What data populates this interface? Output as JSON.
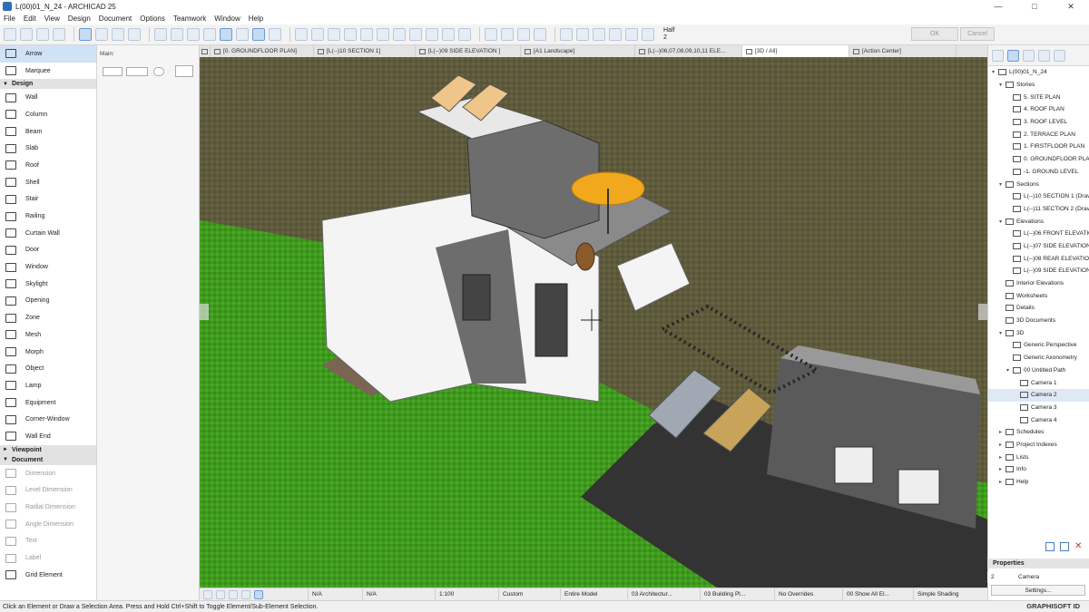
{
  "window": {
    "title": "L(00)01_N_24 - ARCHICAD 25",
    "min": "—",
    "max": "□",
    "close": "✕"
  },
  "menu": [
    "File",
    "Edit",
    "View",
    "Design",
    "Document",
    "Options",
    "Teamwork",
    "Window",
    "Help"
  ],
  "toolbar": {
    "half_label": "Half",
    "half_value": "2",
    "ok": "OK",
    "cancel": "Cancel"
  },
  "tabs": [
    "[0. GROUNDFLOOR PLAN]",
    "[L(--)10 SECTION 1]",
    "[L(--)09 SIDE ELEVATION ]",
    "[A1 Landscape]",
    "[L(--)06,07,08,09,10,11 ELE...",
    "[3D / All]",
    "[Action Center]"
  ],
  "toolbox": {
    "select": [
      {
        "label": "Arrow",
        "active": true
      },
      {
        "label": "Marquee"
      }
    ],
    "design_title": "Design",
    "design": [
      "Wall",
      "Column",
      "Beam",
      "Slab",
      "Roof",
      "Shell",
      "Stair",
      "Railing",
      "Curtain Wall",
      "Door",
      "Window",
      "Skylight",
      "Opening",
      "Zone",
      "Mesh",
      "Morph",
      "Object",
      "Lamp",
      "Equipment",
      "Corner-Window",
      "Wall End"
    ],
    "viewpoint_title": "Viewpoint",
    "document_title": "Document",
    "document": [
      "Dimension",
      "Level Dimension",
      "Radial Dimension",
      "Angle Dimension",
      "Text",
      "Label",
      "Grid Element"
    ]
  },
  "infobox": {
    "main_label": "Main:"
  },
  "view_status": [
    "N/A",
    "N/A",
    "1:100",
    "Custom",
    "Entire Model",
    "03 Architectur...",
    "03 Building Pl...",
    "No Overrides",
    "00 Show All El...",
    "Simple Shading"
  ],
  "status_text": "Click an Element or Draw a Selection Area. Press and Hold Ctrl+Shift to Toggle Element/Sub-Element Selection.",
  "graphisoft_id": "GRAPHISOFT ID",
  "navigator": {
    "tree": [
      {
        "label": "L(00)01_N_24",
        "level": 0,
        "tw": "▾"
      },
      {
        "label": "Stories",
        "level": 1,
        "tw": "▾"
      },
      {
        "label": "5. SITE PLAN",
        "level": 2
      },
      {
        "label": "4. ROOF PLAN",
        "level": 2
      },
      {
        "label": "3. ROOF LEVEL",
        "level": 2
      },
      {
        "label": "2. TERRACE PLAN",
        "level": 2
      },
      {
        "label": "1. FIRSTFLOOR PLAN",
        "level": 2
      },
      {
        "label": "0. GROUNDFLOOR PLA",
        "level": 2
      },
      {
        "label": "-1. GROUND LEVEL",
        "level": 2
      },
      {
        "label": "Sections",
        "level": 1,
        "tw": "▾"
      },
      {
        "label": "L(--)10 SECTION 1 (Drav",
        "level": 2
      },
      {
        "label": "L(--)11 SECTION 2 (Drav",
        "level": 2
      },
      {
        "label": "Elevations",
        "level": 1,
        "tw": "▾"
      },
      {
        "label": "L(--)06 FRONT ELEVATIO",
        "level": 2
      },
      {
        "label": "L(--)07 SIDE ELEVATION",
        "level": 2
      },
      {
        "label": "L(--)08 REAR ELEVATION",
        "level": 2
      },
      {
        "label": "L(--)09 SIDE ELEVATION",
        "level": 2
      },
      {
        "label": "Interior Elevations",
        "level": 1
      },
      {
        "label": "Worksheets",
        "level": 1
      },
      {
        "label": "Details",
        "level": 1
      },
      {
        "label": "3D Documents",
        "level": 1
      },
      {
        "label": "3D",
        "level": 1,
        "tw": "▾"
      },
      {
        "label": "Generic Perspective",
        "level": 2
      },
      {
        "label": "Generic Axonometry",
        "level": 2
      },
      {
        "label": "00 Untitled Path",
        "level": 2,
        "tw": "▾"
      },
      {
        "label": "Camera 1",
        "level": 3
      },
      {
        "label": "Camera 2",
        "level": 3,
        "selected": true
      },
      {
        "label": "Camera 3",
        "level": 3
      },
      {
        "label": "Camera 4",
        "level": 3
      },
      {
        "label": "Schedules",
        "level": 1,
        "tw": "▸"
      },
      {
        "label": "Project Indexes",
        "level": 1,
        "tw": "▸"
      },
      {
        "label": "Lists",
        "level": 1,
        "tw": "▸"
      },
      {
        "label": "Info",
        "level": 1,
        "tw": "▸"
      },
      {
        "label": "Help",
        "level": 1,
        "tw": "▸"
      }
    ]
  },
  "properties": {
    "title": "Properties",
    "id": "2",
    "name": "Camera",
    "settings": "Settings..."
  },
  "colors": {
    "grass_top": "#5e5a3c",
    "grass_front": "#3f9a1e",
    "wall_white": "#f4f4f4",
    "wall_gray": "#6d6d6d",
    "umbrella": "#f2a81d",
    "road": "#333333"
  }
}
